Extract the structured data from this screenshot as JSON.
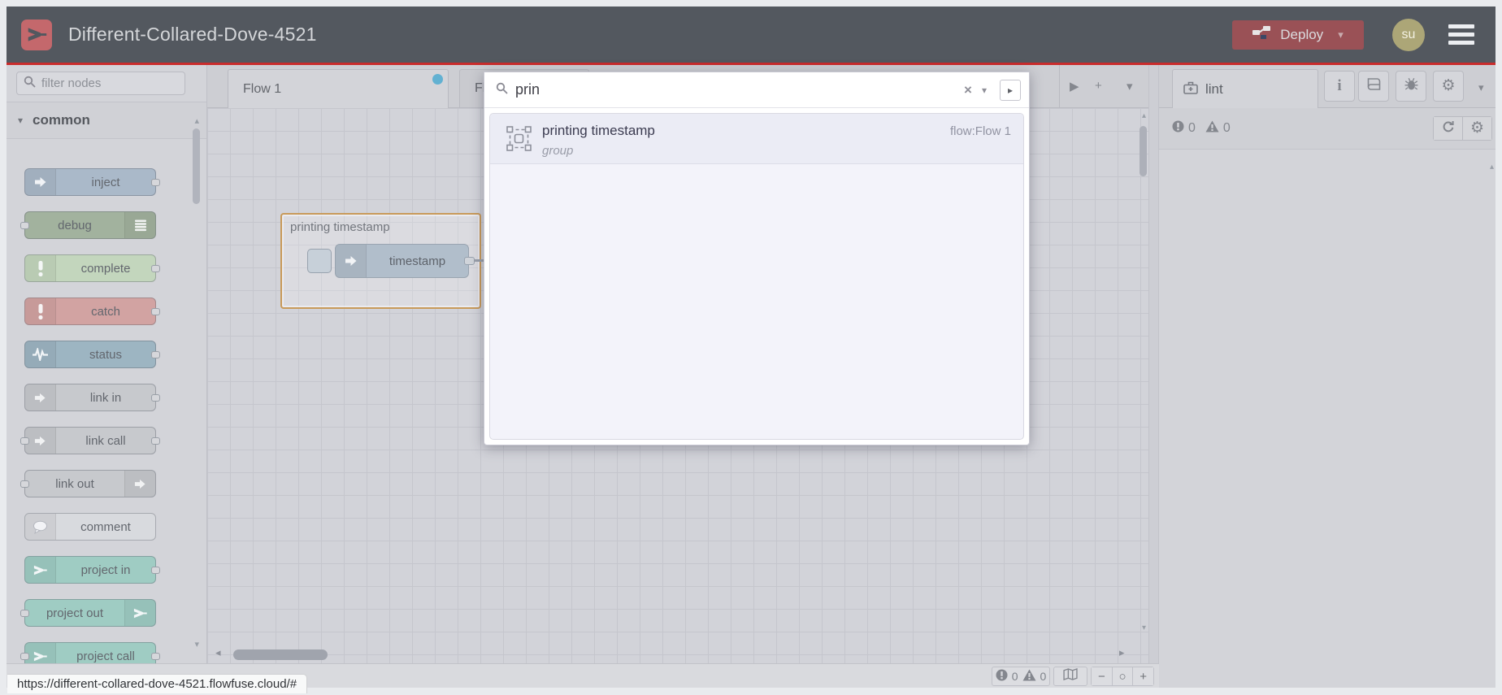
{
  "header": {
    "title": "Different-Collared-Dove-4521",
    "deploy_label": "Deploy",
    "avatar_initials": "su"
  },
  "palette": {
    "filter_placeholder": "filter nodes",
    "category_label": "common",
    "nodes": [
      {
        "label": "inject",
        "color": "#aab9c9",
        "icon": "inject-arrow",
        "icon_side": "left",
        "ports": "right"
      },
      {
        "label": "debug",
        "color": "#a2b29e",
        "icon": "debug-lines",
        "icon_side": "right",
        "ports": "left"
      },
      {
        "label": "complete",
        "color": "#c3d6bd",
        "icon": "exclamation",
        "icon_side": "left",
        "ports": "right"
      },
      {
        "label": "catch",
        "color": "#d2a3a2",
        "icon": "exclamation",
        "icon_side": "left",
        "ports": "right"
      },
      {
        "label": "status",
        "color": "#9db5c2",
        "icon": "pulse",
        "icon_side": "left",
        "ports": "right"
      },
      {
        "label": "link in",
        "color": "#c7c9cd",
        "icon": "link-arrow",
        "icon_side": "left",
        "ports": "right"
      },
      {
        "label": "link call",
        "color": "#c7c9cd",
        "icon": "link-arrow",
        "icon_side": "left",
        "ports": "both"
      },
      {
        "label": "link out",
        "color": "#c7c9cd",
        "icon": "link-arrow",
        "icon_side": "right",
        "ports": "left"
      },
      {
        "label": "comment",
        "color": "#d8dade",
        "icon": "comment-bubble",
        "icon_side": "left",
        "ports": "none"
      },
      {
        "label": "project in",
        "color": "#9fccc3",
        "icon": "flowfuse",
        "icon_side": "left",
        "ports": "right"
      },
      {
        "label": "project out",
        "color": "#9fccc3",
        "icon": "flowfuse",
        "icon_side": "right",
        "ports": "left"
      },
      {
        "label": "project call",
        "color": "#9fccc3",
        "icon": "flowfuse",
        "icon_side": "left",
        "ports": "both"
      }
    ]
  },
  "canvas": {
    "tabs": [
      {
        "label": "Flow 1",
        "modified": true
      },
      {
        "label": "Fl"
      }
    ],
    "group": {
      "label": "printing timestamp",
      "node_label": "timestamp"
    },
    "footer": {
      "errors": "0",
      "warnings": "0"
    }
  },
  "search": {
    "query": "prin",
    "result": {
      "title": "printing timestamp",
      "type": "group",
      "location": "flow:Flow 1"
    }
  },
  "sidebar": {
    "tab_label": "lint",
    "errors": "0",
    "warnings": "0"
  },
  "statusbar": {
    "url": "https://different-collared-dove-4521.flowfuse.cloud/#"
  },
  "colors": {
    "header_bg": "#53585f",
    "accent_red": "#c92c2c",
    "deploy_red": "#9a5156",
    "modified_dot": "#62b1d2",
    "group_border": "#c89a5a",
    "logo_red": "#c4686c"
  }
}
